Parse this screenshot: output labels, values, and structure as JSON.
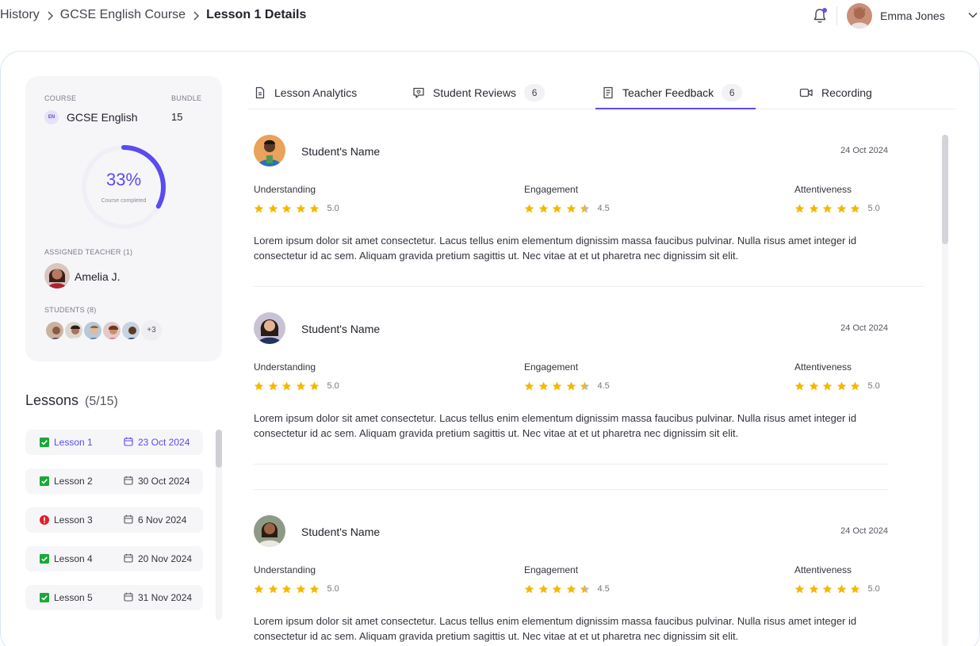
{
  "breadcrumb": [
    "History",
    "GCSE English Course",
    "Lesson 1 Details"
  ],
  "header": {
    "user_name": "Emma Jones",
    "notification_dot": "#6c4cf1"
  },
  "course_card": {
    "course_label": "COURSE",
    "course_badge": "EN",
    "course_name": "GCSE English",
    "bundle_label": "BUNDLE",
    "bundle_value": "15",
    "progress_percent": "33%",
    "progress_fraction": 0.33,
    "progress_sub": "Course completed",
    "teacher_label": "ASSIGNED TEACHER (1)",
    "teacher_name": "Amelia J.",
    "students_label": "STUDENTS (8)",
    "students_more": "+3"
  },
  "lessons": {
    "title": "Lessons",
    "count": "(5/15)",
    "items": [
      {
        "name": "Lesson 1",
        "date": "23 Oct 2024",
        "status": "done",
        "active": true
      },
      {
        "name": "Lesson 2",
        "date": "30 Oct 2024",
        "status": "done",
        "active": false
      },
      {
        "name": "Lesson 3",
        "date": "6 Nov 2024",
        "status": "missed",
        "active": false
      },
      {
        "name": "Lesson 4",
        "date": "20 Nov 2024",
        "status": "done",
        "active": false
      },
      {
        "name": "Lesson 5",
        "date": "31 Nov 2024",
        "status": "done",
        "active": false
      }
    ]
  },
  "tabs": [
    {
      "label": "Lesson Analytics",
      "icon": "document-icon",
      "badge": ""
    },
    {
      "label": "Student Reviews",
      "icon": "chat-heart-icon",
      "badge": "6"
    },
    {
      "label": "Teacher Feedback",
      "icon": "clipboard-icon",
      "badge": "6",
      "active": true
    },
    {
      "label": "Recording",
      "icon": "video-icon",
      "badge": ""
    }
  ],
  "feedback": [
    {
      "name": "Student's Name",
      "date": "24 Oct 2024",
      "metrics": [
        {
          "label": "Understanding",
          "score": "5.0",
          "rating": 5
        },
        {
          "label": "Engagement",
          "score": "4.5",
          "rating": 4.5
        },
        {
          "label": "Attentiveness",
          "score": "5.0",
          "rating": 5
        }
      ],
      "text": "Lorem ipsum dolor sit amet consectetur. Lacus tellus enim elementum dignissim massa faucibus pulvinar. Nulla risus amet integer id consectetur id ac sem. Aliquam gravida pretium sagittis ut. Nec vitae at et ut pharetra nec dignissim sit elit."
    },
    {
      "name": "Student's Name",
      "date": "24 Oct 2024",
      "metrics": [
        {
          "label": "Understanding",
          "score": "5.0",
          "rating": 5
        },
        {
          "label": "Engagement",
          "score": "4.5",
          "rating": 4.5
        },
        {
          "label": "Attentiveness",
          "score": "5.0",
          "rating": 5
        }
      ],
      "text": "Lorem ipsum dolor sit amet consectetur. Lacus tellus enim elementum dignissim massa faucibus pulvinar. Nulla risus amet integer id consectetur id ac sem. Aliquam gravida pretium sagittis ut. Nec vitae at et ut pharetra nec dignissim sit elit."
    },
    {
      "name": "Student's Name",
      "date": "24 Oct 2024",
      "metrics": [
        {
          "label": "Understanding",
          "score": "5.0",
          "rating": 5
        },
        {
          "label": "Engagement",
          "score": "4.5",
          "rating": 4.5
        },
        {
          "label": "Attentiveness",
          "score": "5.0",
          "rating": 5
        }
      ],
      "text": "Lorem ipsum dolor sit amet consectetur. Lacus tellus enim elementum dignissim massa faucibus pulvinar. Nulla risus amet integer id consectetur id ac sem. Aliquam gravida pretium sagittis ut. Nec vitae at et ut pharetra nec dignissim sit elit."
    }
  ],
  "colors": {
    "accent": "#5b4bf0",
    "star": "#f5b800",
    "star_empty": "#b8b8c0",
    "done": "#1aa83a",
    "missed": "#e0202a"
  }
}
